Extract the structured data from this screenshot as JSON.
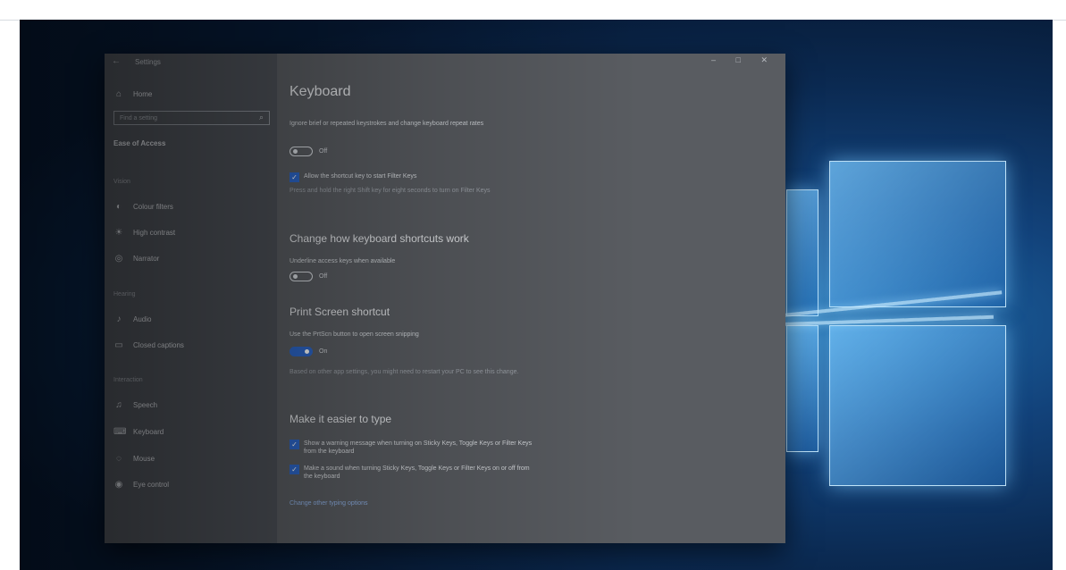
{
  "window": {
    "title": "Settings",
    "controls": "– □ ✕"
  },
  "sidebar": {
    "home_label": "Home",
    "search_placeholder": "Find a setting",
    "ease_title": "Ease of Access",
    "sections": {
      "vision": "Vision",
      "hearing": "Hearing",
      "interaction": "Interaction"
    },
    "items": {
      "color_filters": "Colour filters",
      "high_contrast": "High contrast",
      "narrator": "Narrator",
      "audio": "Audio",
      "closed_captions": "Closed captions",
      "speech": "Speech",
      "keyboard": "Keyboard",
      "mouse": "Mouse",
      "eye_control": "Eye control"
    }
  },
  "main": {
    "title": "Keyboard",
    "filter_keys_desc": "Ignore brief or repeated keystrokes and change keyboard repeat rates",
    "filter_keys_toggle": "Off",
    "filter_keys_shortcut_cb": "Allow the shortcut key to start Filter Keys",
    "filter_keys_shortcut_hint": "Press and hold the right Shift key for eight seconds to turn on Filter Keys",
    "shortcuts_heading": "Change how keyboard shortcuts work",
    "underline_access_desc": "Underline access keys when available",
    "underline_toggle": "Off",
    "print_screen_heading": "Print Screen shortcut",
    "print_screen_desc": "Use the PrtScn button to open screen snipping",
    "print_screen_toggle": "On",
    "print_screen_hint": "Based on other app settings, you might need to restart your PC to see this change.",
    "easier_heading": "Make it easier to type",
    "warning_cb": "Show a warning message when turning on Sticky Keys, Toggle Keys or Filter Keys from the keyboard",
    "sound_cb": "Make a sound when turning Sticky Keys, Toggle Keys or Filter Keys on or off from the keyboard",
    "other_typing_link": "Change other typing options"
  },
  "icons": {
    "back": "back-arrow",
    "home": "home",
    "search": "search",
    "color": "color-filter",
    "contrast": "contrast",
    "narrator": "narrator",
    "audio": "audio",
    "captions": "captions",
    "speech": "microphone",
    "keyboard": "keyboard",
    "mouse": "mouse",
    "eye": "eye"
  }
}
